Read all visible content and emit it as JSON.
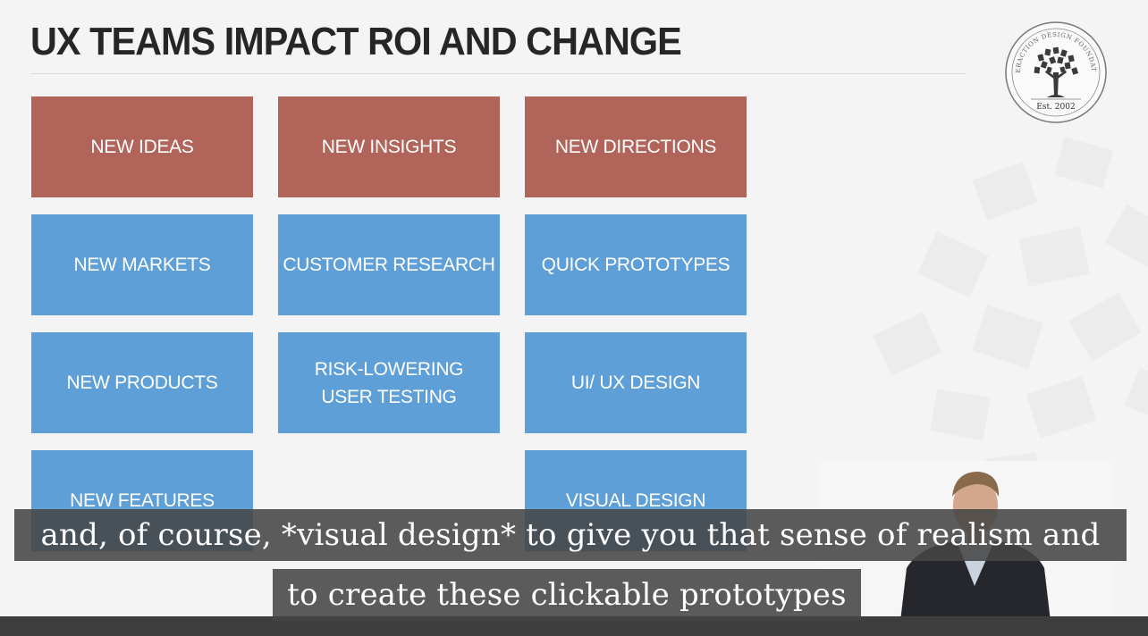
{
  "slide": {
    "title": "UX TEAMS IMPACT ROI AND CHANGE",
    "tiles": [
      {
        "label": "NEW IDEAS",
        "color": "#b1645a"
      },
      {
        "label": "NEW INSIGHTS",
        "color": "#b1645a"
      },
      {
        "label": "NEW DIRECTIONS",
        "color": "#b1645a"
      },
      {
        "label": "NEW MARKETS",
        "color": "#5f9fd8"
      },
      {
        "label": "CUSTOMER RESEARCH",
        "color": "#5f9fd8"
      },
      {
        "label": "QUICK PROTOTYPES",
        "color": "#5f9fd8"
      },
      {
        "label": "NEW PRODUCTS",
        "color": "#5f9fd8"
      },
      {
        "label": "RISK-LOWERING USER TESTING",
        "color": "#5f9fd8"
      },
      {
        "label": "UI/ UX DESIGN",
        "color": "#5f9fd8"
      },
      {
        "label": "NEW FEATURES",
        "color": "#5f9fd8"
      },
      {
        "label": "VISUAL DESIGN",
        "color": "#5f9fd8"
      }
    ]
  },
  "logo": {
    "ring_text": "INTERACTION DESIGN FOUNDATION",
    "est": "Est. 2002"
  },
  "captions": {
    "line1": "and, of course, *visual design* to give you that sense of realism and",
    "line2": "to create these clickable prototypes"
  },
  "presenter": {
    "accent": "#2aa4dc"
  }
}
